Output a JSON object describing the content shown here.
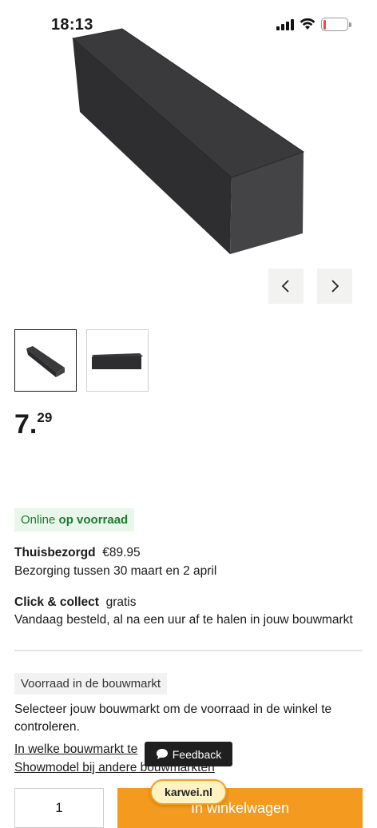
{
  "status_bar": {
    "time": "18:13",
    "battery": "14",
    "battery_level": 0.14
  },
  "gallery": {
    "prev_icon": "chevron-left-icon",
    "next_icon": "chevron-right-icon"
  },
  "price": {
    "whole": "7.",
    "cents": "29"
  },
  "stock": {
    "prefix": "Online",
    "status": "op voorraad"
  },
  "delivery": {
    "home_label": "Thuisbezorgd",
    "home_price": "€89.95",
    "home_window": "Bezorging tussen 30 maart en 2 april",
    "collect_label": "Click & collect",
    "collect_price": "gratis",
    "collect_note": "Vandaag besteld, al na een uur af te halen in jouw bouwmarkt"
  },
  "store_stock": {
    "badge": "Voorraad in de bouwmarkt",
    "line1": "Selecteer jouw bouwmarkt om de voorraad in de winkel te",
    "line2": "controleren.",
    "link1": "In welke bouwmarkt te",
    "link2": "Showmodel bij andere bouwmarkten"
  },
  "feedback": {
    "label": "Feedback",
    "icon": "chat-bubble-icon"
  },
  "cart": {
    "quantity": "1",
    "button": "In winkelwagen"
  },
  "browser": {
    "domain": "karwei.nl"
  },
  "colors": {
    "accent": "#f39a1f",
    "stock_green": "#1f7a33",
    "stock_bg": "#e9f6ea"
  }
}
